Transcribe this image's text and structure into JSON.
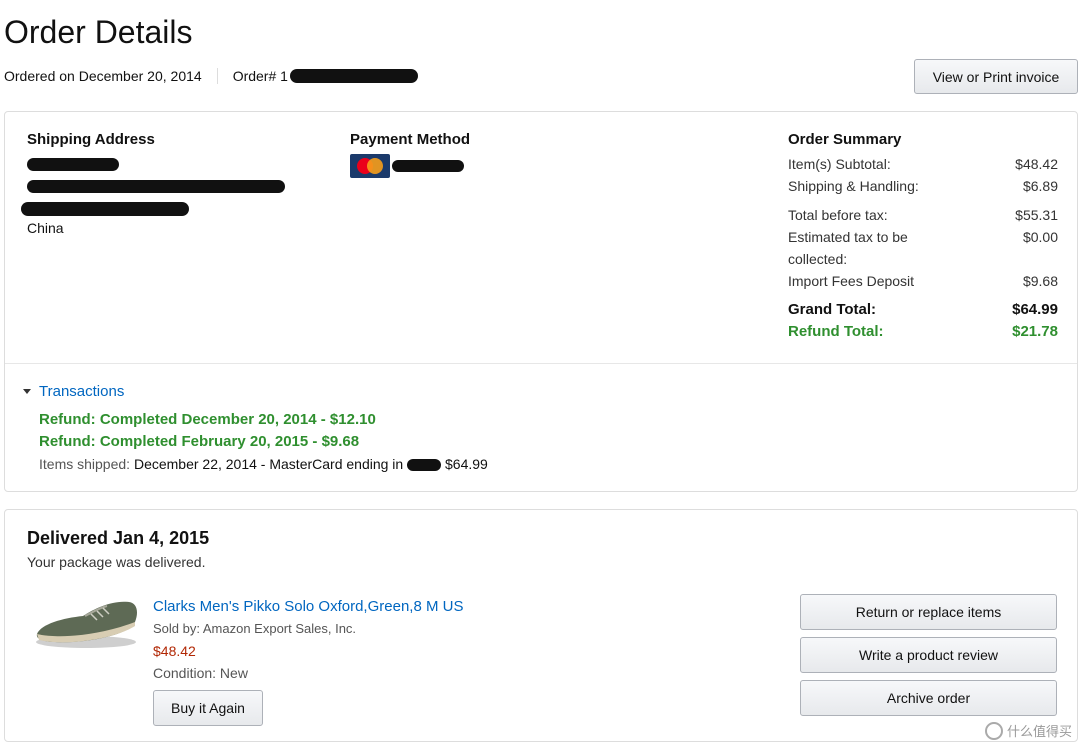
{
  "header": {
    "title": "Order Details",
    "ordered_on": "Ordered on December 20, 2014",
    "order_number_prefix": "Order# 1",
    "invoice_button": "View or Print invoice"
  },
  "shipping": {
    "heading": "Shipping Address",
    "country": "China"
  },
  "payment": {
    "heading": "Payment Method",
    "card_icon": "mastercard-icon"
  },
  "summary": {
    "heading": "Order Summary",
    "rows": [
      {
        "label": "Item(s) Subtotal:",
        "value": "$48.42"
      },
      {
        "label": "Shipping & Handling:",
        "value": "$6.89"
      },
      {
        "label": "Total before tax:",
        "value": "$55.31"
      },
      {
        "label": "Estimated tax to be collected:",
        "value": "$0.00"
      },
      {
        "label": "Import Fees Deposit",
        "value": "$9.68"
      }
    ],
    "grand_total_label": "Grand Total:",
    "grand_total_value": "$64.99",
    "refund_total_label": "Refund Total:",
    "refund_total_value": "$21.78"
  },
  "transactions": {
    "toggle_label": "Transactions",
    "refund_1": "Refund: Completed December 20, 2014 - $12.10",
    "refund_2": "Refund: Completed February 20, 2015 - $9.68",
    "shipped_label": "Items shipped:",
    "shipped_text": "December 22, 2014 - MasterCard ending in",
    "shipped_amount": "$64.99"
  },
  "delivery": {
    "title": "Delivered Jan 4, 2015",
    "subtitle": "Your package was delivered.",
    "item": {
      "title": "Clarks Men's Pikko Solo Oxford,Green,8 M US",
      "seller": "Sold by: Amazon Export Sales, Inc.",
      "price": "$48.42",
      "condition": "Condition: New",
      "buy_again": "Buy it Again"
    },
    "actions": {
      "return": "Return or replace items",
      "review": "Write a product review",
      "archive": "Archive order"
    }
  },
  "watermark": "什么值得买",
  "colors": {
    "link": "#0066c0",
    "refund_green": "#2f8f2f",
    "price_red": "#b12704"
  }
}
